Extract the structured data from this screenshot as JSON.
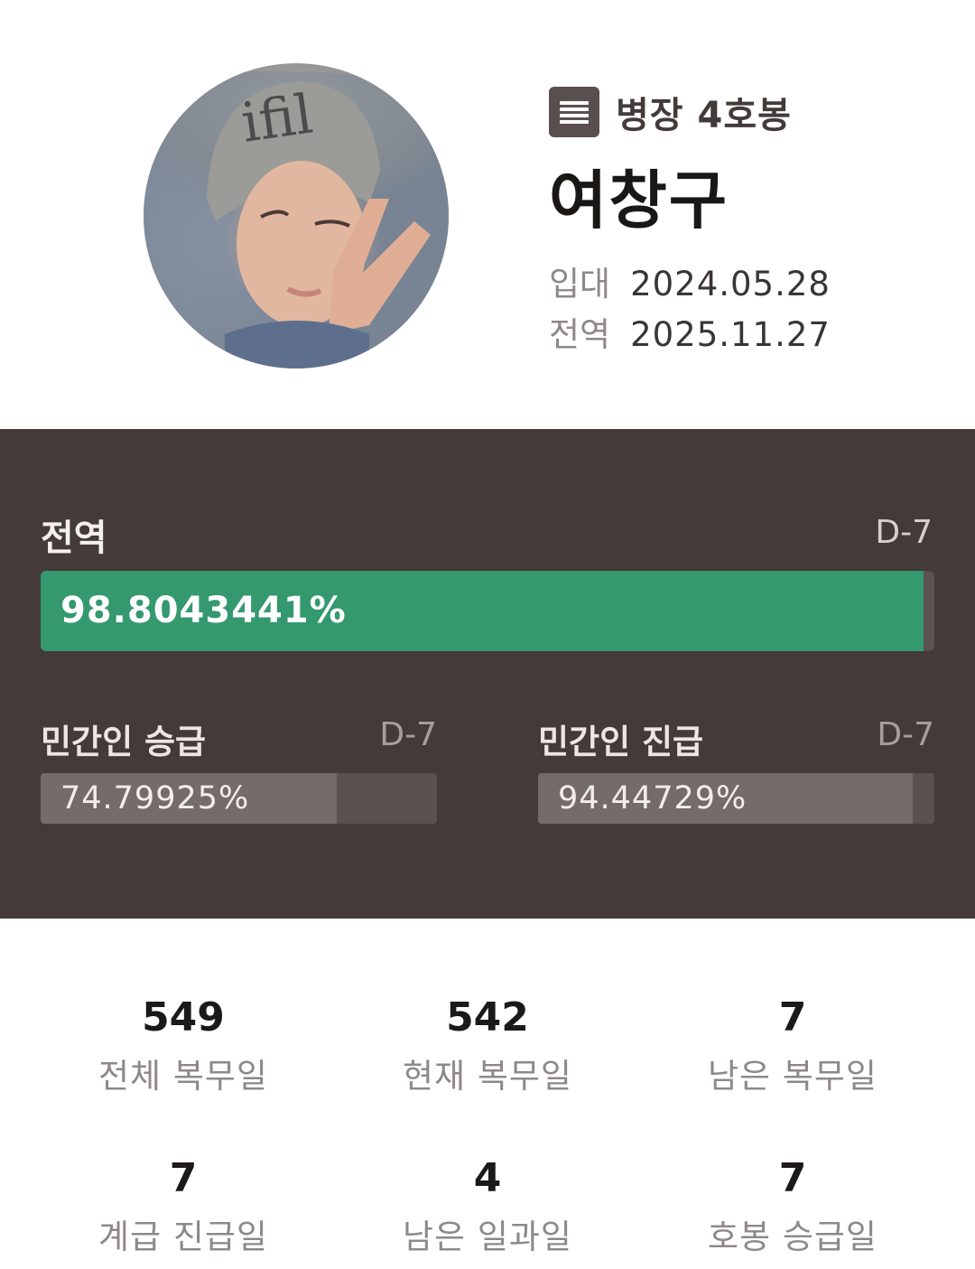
{
  "profile": {
    "rank_label": "병장 4호봉",
    "name": "여창구",
    "enlist_label": "입대",
    "enlist_date": "2024.05.28",
    "discharge_label": "전역",
    "discharge_date": "2025.11.27"
  },
  "progress": {
    "main": {
      "title": "전역",
      "dday": "D-7",
      "percent_text": "98.8043441%",
      "fraction": 0.988043441,
      "fill_color": "#34996f"
    },
    "promotion": {
      "title": "민간인 승급",
      "dday": "D-7",
      "percent_text": "74.79925%",
      "fraction": 0.7479925
    },
    "advance": {
      "title": "민간인 진급",
      "dday": "D-7",
      "percent_text": "94.44729%",
      "fraction": 0.9444729
    }
  },
  "stats": [
    {
      "value": "549",
      "label": "전체 복무일"
    },
    {
      "value": "542",
      "label": "현재 복무일"
    },
    {
      "value": "7",
      "label": "남은 복무일"
    },
    {
      "value": "7",
      "label": "계급 진급일"
    },
    {
      "value": "4",
      "label": "남은 일과일"
    },
    {
      "value": "7",
      "label": "호봉 승급일"
    }
  ],
  "icons": {
    "rank": "list-menu-icon"
  },
  "colors": {
    "panel_bg": "#433a39",
    "accent": "#34996f"
  }
}
